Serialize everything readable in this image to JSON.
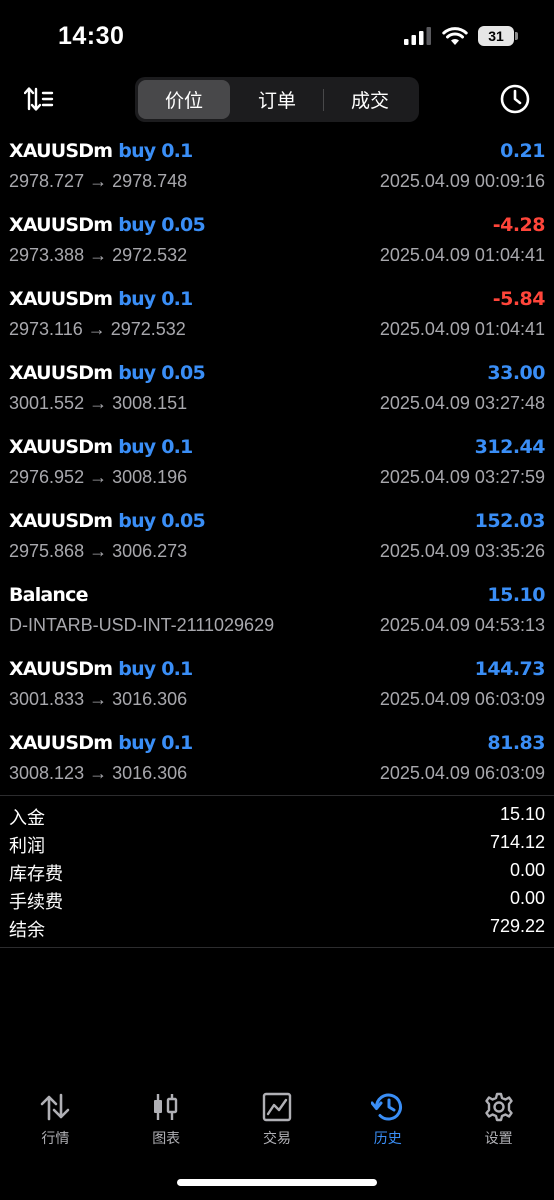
{
  "status": {
    "time": "14:30",
    "battery": "31"
  },
  "toolbar": {
    "segments": [
      {
        "label": "价位",
        "active": true
      },
      {
        "label": "订单",
        "active": false
      },
      {
        "label": "成交",
        "active": false
      }
    ]
  },
  "deals": [
    {
      "symbol": "XAUUSDm",
      "side": "buy 0.1",
      "profit": "0.21",
      "profit_sign": "positive",
      "prices": "2978.727 → 2978.748",
      "time": "2025.04.09 00:09:16"
    },
    {
      "symbol": "XAUUSDm",
      "side": "buy 0.05",
      "profit": "-4.28",
      "profit_sign": "negative",
      "prices": "2973.388 → 2972.532",
      "time": "2025.04.09 01:04:41"
    },
    {
      "symbol": "XAUUSDm",
      "side": "buy 0.1",
      "profit": "-5.84",
      "profit_sign": "negative",
      "prices": "2973.116 → 2972.532",
      "time": "2025.04.09 01:04:41"
    },
    {
      "symbol": "XAUUSDm",
      "side": "buy 0.05",
      "profit": "33.00",
      "profit_sign": "positive",
      "prices": "3001.552 → 3008.151",
      "time": "2025.04.09 03:27:48"
    },
    {
      "symbol": "XAUUSDm",
      "side": "buy 0.1",
      "profit": "312.44",
      "profit_sign": "positive",
      "prices": "2976.952 → 3008.196",
      "time": "2025.04.09 03:27:59"
    },
    {
      "symbol": "XAUUSDm",
      "side": "buy 0.05",
      "profit": "152.03",
      "profit_sign": "positive",
      "prices": "2975.868 → 3006.273",
      "time": "2025.04.09 03:35:26"
    },
    {
      "symbol": "Balance",
      "side": "",
      "profit": "15.10",
      "profit_sign": "positive",
      "prices": "D-INTARB-USD-INT-2111029629",
      "time": "2025.04.09 04:53:13"
    },
    {
      "symbol": "XAUUSDm",
      "side": "buy 0.1",
      "profit": "144.73",
      "profit_sign": "positive",
      "prices": "3001.833 → 3016.306",
      "time": "2025.04.09 06:03:09"
    },
    {
      "symbol": "XAUUSDm",
      "side": "buy 0.1",
      "profit": "81.83",
      "profit_sign": "positive",
      "prices": "3008.123 → 3016.306",
      "time": "2025.04.09 06:03:09"
    }
  ],
  "summary": [
    {
      "label": "入金",
      "value": "15.10"
    },
    {
      "label": "利润",
      "value": "714.12"
    },
    {
      "label": "库存费",
      "value": "0.00"
    },
    {
      "label": "手续费",
      "value": "0.00"
    },
    {
      "label": "结余",
      "value": "729.22"
    }
  ],
  "tabbar": [
    {
      "label": "行情",
      "icon": "quotes-arrows-icon",
      "active": false
    },
    {
      "label": "图表",
      "icon": "candlestick-chart-icon",
      "active": false
    },
    {
      "label": "交易",
      "icon": "trade-chart-icon",
      "active": false
    },
    {
      "label": "历史",
      "icon": "history-clock-icon",
      "active": true
    },
    {
      "label": "设置",
      "icon": "settings-gear-icon",
      "active": false
    }
  ],
  "colors": {
    "accent": "#3a8ef6",
    "negative": "#ff453a",
    "muted": "#a8a8ad",
    "background": "#000000"
  }
}
